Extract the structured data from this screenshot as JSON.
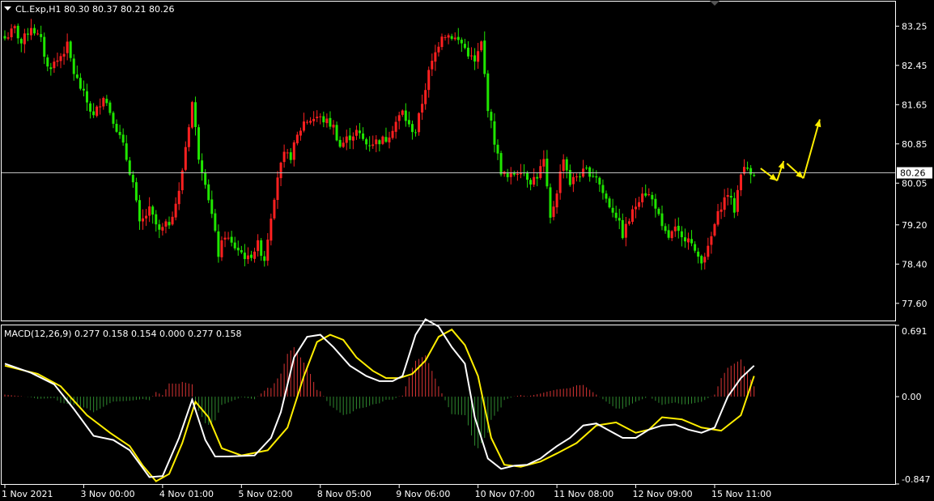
{
  "colors": {
    "background": "#000000",
    "frame": "#ffffff",
    "bull": "#ff2020",
    "bear": "#1fe600",
    "price_line": "#c0c0c0",
    "price_label_bg": "#ffffff",
    "arrow": "#ffee00",
    "macd_line": "#ffffff",
    "signal_line": "#ffee00",
    "hist_pos": "#d83434",
    "hist_neg": "#2f8a2f"
  },
  "chart_data": [
    {
      "type": "candlestick",
      "title": "CL.Exp,H1  80.30 80.37 80.21 80.26",
      "ylim": [
        77.25,
        83.75
      ],
      "yticks": [
        "83.25",
        "82.45",
        "81.65",
        "80.85",
        "80.05",
        "79.20",
        "78.40",
        "77.60"
      ],
      "ytick_values": [
        83.25,
        82.45,
        81.65,
        80.85,
        80.05,
        79.2,
        78.4,
        77.6
      ],
      "current_price": 80.26,
      "current_price_label": "80.26",
      "anchors": [
        [
          0,
          83.0
        ],
        [
          3,
          83.2
        ],
        [
          5,
          82.9
        ],
        [
          8,
          83.25
        ],
        [
          11,
          82.95
        ],
        [
          13,
          82.4
        ],
        [
          16,
          82.55
        ],
        [
          19,
          82.85
        ],
        [
          21,
          82.3
        ],
        [
          24,
          81.85
        ],
        [
          27,
          81.4
        ],
        [
          30,
          81.85
        ],
        [
          33,
          81.35
        ],
        [
          36,
          80.8
        ],
        [
          39,
          80.05
        ],
        [
          41,
          79.2
        ],
        [
          44,
          79.5
        ],
        [
          47,
          79.05
        ],
        [
          50,
          79.25
        ],
        [
          53,
          79.85
        ],
        [
          55,
          80.8
        ],
        [
          57,
          81.7
        ],
        [
          59,
          80.6
        ],
        [
          61,
          80.1
        ],
        [
          63,
          79.4
        ],
        [
          65,
          78.6
        ],
        [
          67,
          79.0
        ],
        [
          69,
          78.8
        ],
        [
          71,
          78.7
        ],
        [
          74,
          78.5
        ],
        [
          77,
          78.8
        ],
        [
          79,
          78.5
        ],
        [
          81,
          79.4
        ],
        [
          83,
          80.2
        ],
        [
          85,
          80.6
        ],
        [
          87,
          80.6
        ],
        [
          89,
          81.0
        ],
        [
          91,
          81.3
        ],
        [
          95,
          81.4
        ],
        [
          98,
          81.3
        ],
        [
          100,
          81.2
        ],
        [
          102,
          80.8
        ],
        [
          104,
          80.95
        ],
        [
          107,
          81.1
        ],
        [
          110,
          80.85
        ],
        [
          113,
          80.9
        ],
        [
          116,
          80.95
        ],
        [
          119,
          81.3
        ],
        [
          121,
          81.5
        ],
        [
          123,
          81.2
        ],
        [
          125,
          81.1
        ],
        [
          127,
          81.7
        ],
        [
          129,
          82.3
        ],
        [
          131,
          82.7
        ],
        [
          133,
          83.1
        ],
        [
          136,
          83.05
        ],
        [
          139,
          82.9
        ],
        [
          141,
          82.7
        ],
        [
          143,
          82.5
        ],
        [
          145,
          82.9
        ],
        [
          147,
          81.6
        ],
        [
          149,
          80.9
        ],
        [
          151,
          80.3
        ],
        [
          153,
          80.15
        ],
        [
          155,
          80.25
        ],
        [
          157,
          80.35
        ],
        [
          160,
          80.1
        ],
        [
          162,
          80.2
        ],
        [
          164,
          80.5
        ],
        [
          166,
          79.3
        ],
        [
          168,
          79.9
        ],
        [
          170,
          80.6
        ],
        [
          172,
          80.05
        ],
        [
          174,
          80.2
        ],
        [
          177,
          80.3
        ],
        [
          180,
          80.2
        ],
        [
          182,
          79.85
        ],
        [
          184,
          79.6
        ],
        [
          186,
          79.4
        ],
        [
          188,
          79.0
        ],
        [
          190,
          79.3
        ],
        [
          192,
          79.6
        ],
        [
          194,
          79.9
        ],
        [
          196,
          79.8
        ],
        [
          198,
          79.6
        ],
        [
          200,
          79.1
        ],
        [
          202,
          78.95
        ],
        [
          204,
          79.1
        ],
        [
          206,
          78.9
        ],
        [
          208,
          79.0
        ],
        [
          210,
          78.6
        ],
        [
          212,
          78.5
        ],
        [
          214,
          78.7
        ],
        [
          216,
          79.2
        ],
        [
          218,
          79.6
        ],
        [
          220,
          79.85
        ],
        [
          222,
          79.5
        ],
        [
          224,
          80.3
        ],
        [
          226,
          80.35
        ],
        [
          228,
          80.26
        ]
      ],
      "arrows": [
        {
          "from": [
            230,
            80.35
          ],
          "to": [
            235,
            80.1
          ]
        },
        {
          "from": [
            235,
            80.1
          ],
          "to": [
            237,
            80.5
          ]
        },
        {
          "from": [
            238,
            80.45
          ],
          "to": [
            243,
            80.15
          ]
        },
        {
          "from": [
            243,
            80.15
          ],
          "to": [
            248,
            81.35
          ]
        }
      ]
    },
    {
      "type": "line",
      "title": "MACD(12,26,9) 0.277 0.158 0.154 0.000 0.277 0.158",
      "ylim": [
        -0.847,
        0.691
      ],
      "yticks": [
        "0.691",
        "0.00",
        "-0.847"
      ],
      "ytick_values": [
        0.691,
        0.0,
        -0.847
      ],
      "series": [
        {
          "key": "macd",
          "x": [
            0,
            8,
            15,
            21,
            27,
            33,
            38,
            44,
            48,
            53,
            57,
            61,
            64,
            68,
            76,
            81,
            84,
            88,
            92,
            96,
            100,
            105,
            110,
            114,
            118,
            121,
            125,
            128,
            132,
            136,
            140,
            143,
            147,
            151,
            155,
            159,
            163,
            165,
            168,
            172,
            176,
            180,
            184,
            188,
            192,
            196,
            200,
            204,
            208,
            212,
            216,
            220,
            224,
            228
          ],
          "y": [
            0.32,
            0.23,
            0.12,
            -0.12,
            -0.38,
            -0.42,
            -0.52,
            -0.78,
            -0.77,
            -0.4,
            -0.03,
            -0.42,
            -0.58,
            -0.58,
            -0.57,
            -0.4,
            -0.15,
            0.38,
            0.58,
            0.6,
            0.48,
            0.3,
            0.2,
            0.15,
            0.15,
            0.2,
            0.6,
            0.75,
            0.68,
            0.48,
            0.32,
            -0.2,
            -0.6,
            -0.7,
            -0.67,
            -0.66,
            -0.6,
            -0.55,
            -0.48,
            -0.4,
            -0.28,
            -0.26,
            -0.33,
            -0.4,
            -0.4,
            -0.32,
            -0.28,
            -0.27,
            -0.32,
            -0.35,
            -0.3,
            0.0,
            0.18,
            0.3
          ]
        },
        {
          "key": "signal",
          "x": [
            0,
            10,
            17,
            25,
            32,
            38,
            42,
            46,
            50,
            54,
            58,
            62,
            66,
            72,
            80,
            86,
            91,
            95,
            99,
            103,
            107,
            112,
            116,
            120,
            124,
            128,
            132,
            136,
            140,
            144,
            148,
            152,
            157,
            163,
            168,
            174,
            180,
            186,
            192,
            196,
            200,
            206,
            212,
            218,
            224,
            228
          ],
          "y": [
            0.3,
            0.22,
            0.1,
            -0.18,
            -0.35,
            -0.48,
            -0.67,
            -0.82,
            -0.75,
            -0.45,
            -0.05,
            -0.2,
            -0.5,
            -0.57,
            -0.52,
            -0.3,
            0.2,
            0.53,
            0.6,
            0.55,
            0.38,
            0.25,
            0.18,
            0.18,
            0.22,
            0.35,
            0.58,
            0.65,
            0.5,
            0.2,
            -0.4,
            -0.66,
            -0.68,
            -0.63,
            -0.55,
            -0.45,
            -0.28,
            -0.25,
            -0.35,
            -0.32,
            -0.2,
            -0.22,
            -0.3,
            -0.33,
            -0.18,
            0.2
          ]
        }
      ],
      "histogram_range": [
        0,
        228
      ]
    }
  ],
  "xaxis_labels": [
    {
      "x": 0,
      "label": "1 Nov 2021"
    },
    {
      "x": 24,
      "label": "3 Nov 00:00"
    },
    {
      "x": 48,
      "label": "4 Nov 01:00"
    },
    {
      "x": 72,
      "label": "5 Nov 02:00"
    },
    {
      "x": 96,
      "label": "8 Nov 05:00"
    },
    {
      "x": 120,
      "label": "9 Nov 06:00"
    },
    {
      "x": 144,
      "label": "10 Nov 07:00"
    },
    {
      "x": 168,
      "label": "11 Nov 08:00"
    },
    {
      "x": 192,
      "label": "12 Nov 09:00"
    },
    {
      "x": 216,
      "label": "15 Nov 11:00"
    }
  ]
}
